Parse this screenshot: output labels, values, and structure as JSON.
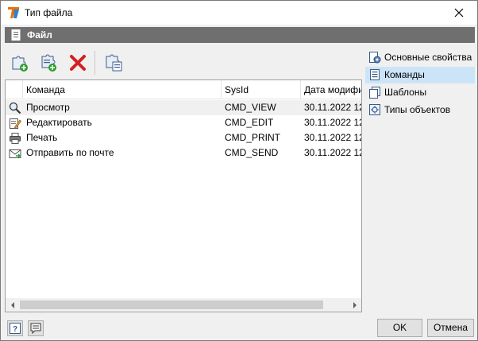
{
  "window": {
    "title": "Тип файла",
    "close_glyph": "✕"
  },
  "header": {
    "title": "Файл"
  },
  "list": {
    "columns": [
      "Команда",
      "SysId",
      "Дата модифи"
    ],
    "rows": [
      {
        "name": "Просмотр",
        "sysid": "CMD_VIEW",
        "date": "30.11.2022 12",
        "icon": "magnifier-icon"
      },
      {
        "name": "Редактировать",
        "sysid": "CMD_EDIT",
        "date": "30.11.2022 12",
        "icon": "edit-pencil-icon"
      },
      {
        "name": "Печать",
        "sysid": "CMD_PRINT",
        "date": "30.11.2022 12",
        "icon": "printer-icon"
      },
      {
        "name": "Отправить по почте",
        "sysid": "CMD_SEND",
        "date": "30.11.2022 12",
        "icon": "mail-icon"
      }
    ]
  },
  "nav": {
    "items": [
      {
        "label": "Основные свойства",
        "icon": "properties-icon"
      },
      {
        "label": "Команды",
        "icon": "commands-icon",
        "active": true
      },
      {
        "label": "Шаблоны",
        "icon": "templates-icon"
      },
      {
        "label": "Типы объектов",
        "icon": "object-types-icon"
      }
    ]
  },
  "buttons": {
    "ok": "OK",
    "cancel": "Отмена"
  },
  "colors": {
    "selected_nav": "#cce4f7",
    "header_band": "#6f6f6f",
    "delete_red": "#d42020",
    "add_green": "#2e9b2e"
  }
}
